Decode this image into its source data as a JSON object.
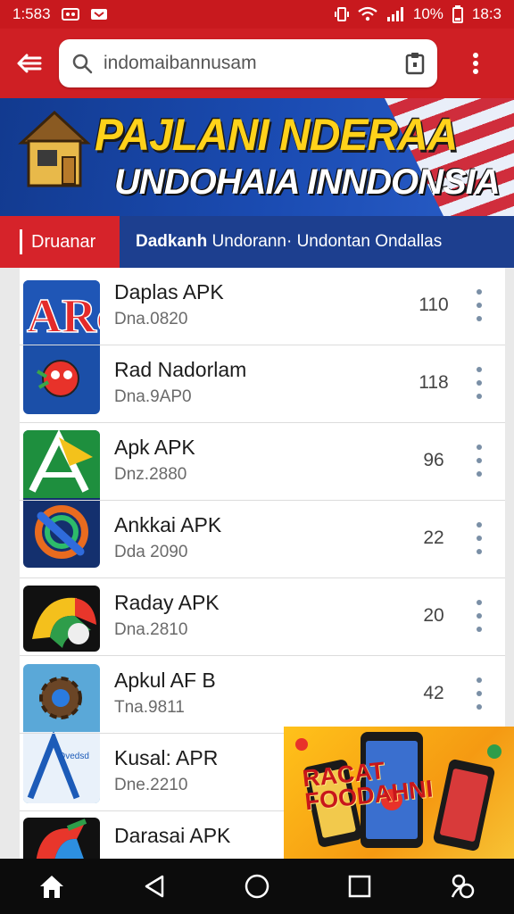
{
  "status_bar": {
    "time_left": "1:583",
    "battery": "10%",
    "time_right": "18:3"
  },
  "search": {
    "query": "indomaibannusam"
  },
  "banner": {
    "title_line1": "PAJLANI NDERAA",
    "title_line2": "UNDOHAIA INNDONSIA"
  },
  "tabs": {
    "active_label": "Druanar",
    "crumb_bold": "Dadkanh",
    "crumb_rest": " Undorann· Undontan Ondallas"
  },
  "apps": [
    {
      "title": "Daplas APK",
      "subtitle": "Dna.0820",
      "count": "110"
    },
    {
      "title": "Rad Nadorlam",
      "subtitle": "Dna.9AP0",
      "count": "118"
    },
    {
      "title": "Apk APK",
      "subtitle": "Dnz.2880",
      "count": "96"
    },
    {
      "title": "Ankkai APK",
      "subtitle": "Dda 2090",
      "count": "22"
    },
    {
      "title": "Raday APK",
      "subtitle": "Dna.2810",
      "count": "20"
    },
    {
      "title": "Apkul AF B",
      "subtitle": "Tna.9811",
      "count": "42"
    },
    {
      "title": "Kusal: APR",
      "subtitle": "Dne.2210",
      "count": ""
    },
    {
      "title": "Darasai APK",
      "subtitle": "",
      "count": ""
    }
  ],
  "icon_labels": {
    "arc": "ARc",
    "devices": "Dvedsd"
  },
  "ad": {
    "text_line1": "RACAT",
    "text_line2": "FOODAHNI"
  },
  "colors": {
    "app_bar": "#cf1f24",
    "tab_strip": "#1d3f8f",
    "banner_yellow": "#ffd21a"
  },
  "icons": [
    "arrow-left-icon",
    "search-icon",
    "clipboard-icon",
    "more-vert-icon",
    "home-icon",
    "back-triangle-icon",
    "circle-home-icon",
    "square-recents-icon",
    "accessibility-icon"
  ]
}
